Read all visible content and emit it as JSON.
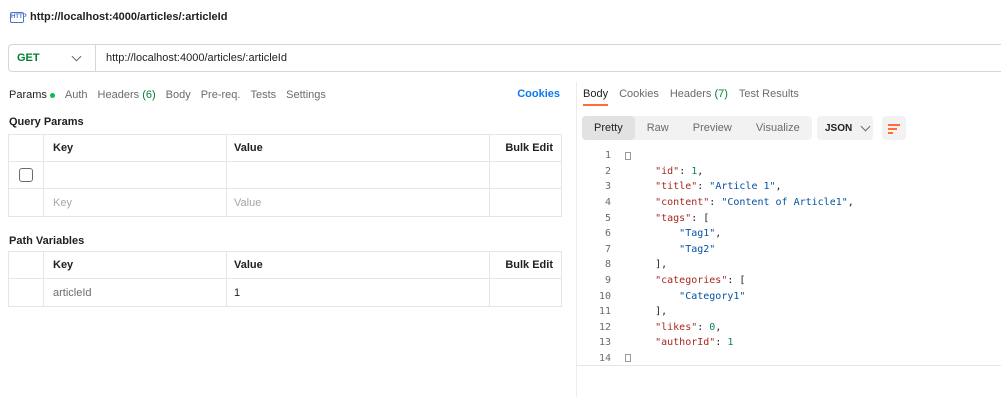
{
  "window": {
    "title": "http://localhost:4000/articles/:articleId"
  },
  "request": {
    "method": "GET",
    "url": "http://localhost:4000/articles/:articleId"
  },
  "request_tabs": [
    {
      "label": "Params"
    },
    {
      "label": "Auth"
    },
    {
      "label": "Headers",
      "count": "(6)"
    },
    {
      "label": "Body"
    },
    {
      "label": "Pre-req."
    },
    {
      "label": "Tests"
    },
    {
      "label": "Settings"
    }
  ],
  "cookies_link": "Cookies",
  "query_params": {
    "title": "Query Params",
    "headers": {
      "key": "Key",
      "value": "Value",
      "bulk": "Bulk Edit"
    },
    "placeholder": {
      "key": "Key",
      "value": "Value"
    }
  },
  "path_variables": {
    "title": "Path Variables",
    "headers": {
      "key": "Key",
      "value": "Value",
      "bulk": "Bulk Edit"
    },
    "rows": [
      {
        "key": "articleId",
        "value": "1"
      }
    ]
  },
  "response_tabs": [
    {
      "label": "Body"
    },
    {
      "label": "Cookies"
    },
    {
      "label": "Headers",
      "count": "(7)"
    },
    {
      "label": "Test Results"
    }
  ],
  "view_options": [
    "Pretty",
    "Raw",
    "Preview",
    "Visualize"
  ],
  "format_select": "JSON",
  "code_lines": [
    {
      "n": "1",
      "text": "{"
    },
    {
      "n": "2",
      "key": "\"id\"",
      "val": "1",
      "vtype": "n",
      "tail": ","
    },
    {
      "n": "3",
      "key": "\"title\"",
      "val": "\"Article 1\"",
      "vtype": "s",
      "tail": ","
    },
    {
      "n": "4",
      "key": "\"content\"",
      "val": "\"Content of Article1\"",
      "vtype": "s",
      "tail": ","
    },
    {
      "n": "5",
      "key": "\"tags\"",
      "val": "[",
      "vtype": "p",
      "tail": ""
    },
    {
      "n": "6",
      "val": "\"Tag1\"",
      "vtype": "s",
      "tail": ",",
      "indent": 2
    },
    {
      "n": "7",
      "val": "\"Tag2\"",
      "vtype": "s",
      "tail": "",
      "indent": 2
    },
    {
      "n": "8",
      "text": "],",
      "indent": 1
    },
    {
      "n": "9",
      "key": "\"categories\"",
      "val": "[",
      "vtype": "p",
      "tail": ""
    },
    {
      "n": "10",
      "val": "\"Category1\"",
      "vtype": "s",
      "tail": "",
      "indent": 2
    },
    {
      "n": "11",
      "text": "],",
      "indent": 1
    },
    {
      "n": "12",
      "key": "\"likes\"",
      "val": "0",
      "vtype": "n",
      "tail": ","
    },
    {
      "n": "13",
      "key": "\"authorId\"",
      "val": "1",
      "vtype": "n",
      "tail": ""
    },
    {
      "n": "14",
      "text": "}"
    }
  ]
}
